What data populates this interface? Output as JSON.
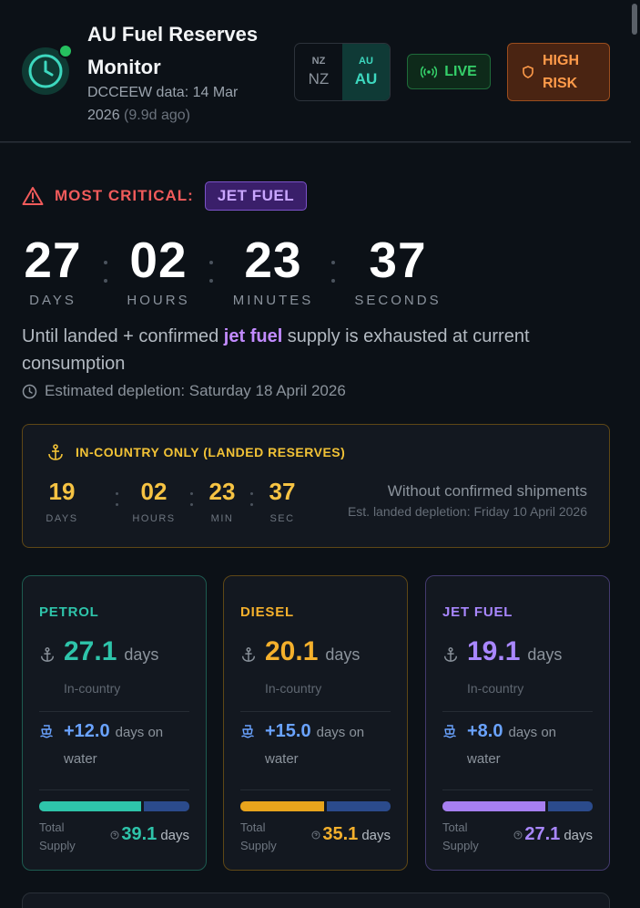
{
  "header": {
    "title": "AU Fuel Reserves Monitor",
    "data_line": "DCCEEW data: 14 Mar 2026",
    "data_age": "(9.9d ago)",
    "region_options": [
      {
        "code_small": "NZ",
        "code_big": "NZ",
        "active": false
      },
      {
        "code_small": "AU",
        "code_big": "AU",
        "active": true
      }
    ],
    "live_label": "LIVE",
    "risk_label": "HIGH RISK"
  },
  "critical": {
    "label": "MOST CRITICAL:",
    "fuel": "JET FUEL",
    "countdown": [
      {
        "value": "27",
        "label": "DAYS"
      },
      {
        "value": "02",
        "label": "HOURS"
      },
      {
        "value": "23",
        "label": "MINUTES"
      },
      {
        "value": "37",
        "label": "SECONDS"
      }
    ],
    "until_pre": "Until landed + confirmed ",
    "until_hl": "jet fuel",
    "until_post": " supply is exhausted at current consumption",
    "estimate": "Estimated depletion: Saturday 18 April 2026"
  },
  "in_country": {
    "title": "IN-COUNTRY ONLY (LANDED RESERVES)",
    "countdown": [
      {
        "value": "19",
        "label": "DAYS"
      },
      {
        "value": "02",
        "label": "HOURS"
      },
      {
        "value": "23",
        "label": "MIN"
      },
      {
        "value": "37",
        "label": "SEC"
      }
    ],
    "note": "Without confirmed shipments",
    "estimate": "Est. landed depletion: Friday 10 April 2026"
  },
  "fuels": [
    {
      "name": "PETROL",
      "days": "27.1",
      "days_unit": "days",
      "in_country_label": "In-country",
      "water": "+12.0",
      "water_unit": "days on",
      "water_unit2": "water",
      "total_label": "Total Supply",
      "total": "39.1",
      "total_unit": "days",
      "in_fraction": 0.69,
      "color": "#2ec4aa"
    },
    {
      "name": "DIESEL",
      "days": "20.1",
      "days_unit": "days",
      "in_country_label": "In-country",
      "water": "+15.0",
      "water_unit": "days on",
      "water_unit2": "water",
      "total_label": "Total Supply",
      "total": "35.1",
      "total_unit": "days",
      "in_fraction": 0.57,
      "color": "#e8a41c"
    },
    {
      "name": "JET FUEL",
      "days": "19.1",
      "days_unit": "days",
      "in_country_label": "In-country",
      "water": "+8.0",
      "water_unit": "days on",
      "water_unit2": "water",
      "total_label": "Total Supply",
      "total": "27.1",
      "total_unit": "days",
      "in_fraction": 0.7,
      "color": "#a67ff0"
    }
  ],
  "colors": {
    "background": "#0c1117",
    "teal": "#2ec4aa",
    "amber": "#f4b02c",
    "purple": "#a987ff",
    "critical_red": "#f15b5b",
    "live_green": "#35d06a",
    "risk_orange": "#ff9b4a",
    "water_blue": "#2b4b8c"
  },
  "icons": [
    "clock-logo-icon",
    "live-signal-icon",
    "shield-icon",
    "alert-triangle-icon",
    "clock-icon",
    "anchor-icon",
    "ship-icon",
    "help-icon"
  ]
}
